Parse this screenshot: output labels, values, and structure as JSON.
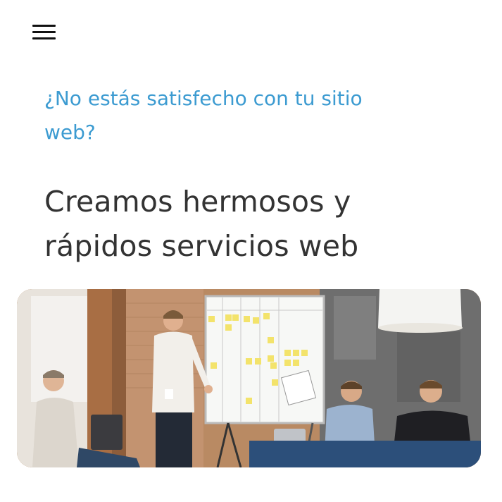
{
  "header": {
    "menu_icon": "hamburger-menu-icon"
  },
  "hero": {
    "subtitle": "¿No estás satisfecho con tu sitio web?",
    "headline": "Creamos hermosos y rápidos servicios web"
  },
  "image": {
    "description_icon": "team-meeting-photo"
  },
  "colors": {
    "accent": "#3c9bd1",
    "headline": "#333333",
    "background": "#ffffff"
  }
}
